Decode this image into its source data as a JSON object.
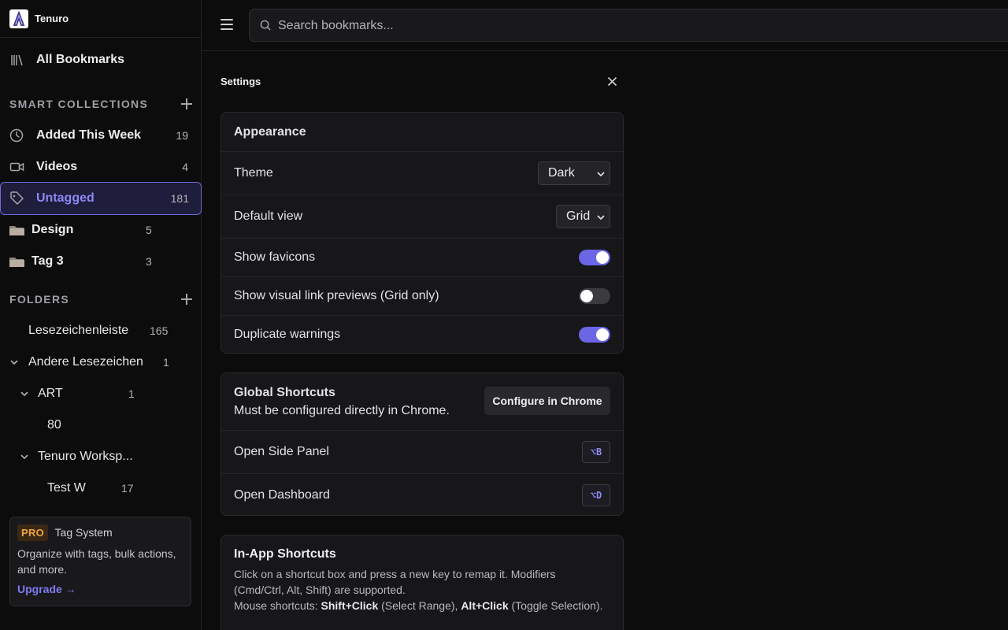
{
  "brand": {
    "name": "Tenuro"
  },
  "sidebar": {
    "all_bookmarks": "All Bookmarks",
    "smart_collections_title": "SMART COLLECTIONS",
    "smart_collections": [
      {
        "label": "Added This Week",
        "count": "19",
        "icon": "clock-icon"
      },
      {
        "label": "Videos",
        "count": "4",
        "icon": "video-icon"
      },
      {
        "label": "Untagged",
        "count": "181",
        "icon": "tag-icon",
        "active": true
      }
    ],
    "tags": [
      {
        "label": "Design",
        "count": "5",
        "icon": "folder-emoji-icon"
      },
      {
        "label": "Tag 3",
        "count": "3",
        "icon": "folder-emoji-icon"
      }
    ],
    "folders_title": "FOLDERS",
    "folders": [
      {
        "label": "Lesezeichenleiste",
        "count": "165",
        "level": 0,
        "expanded": null
      },
      {
        "label": "Andere Lesezeichen",
        "count": "1",
        "level": 0,
        "expanded": true
      },
      {
        "label": "ART",
        "count": "1",
        "level": 1,
        "expanded": true
      },
      {
        "label": "80",
        "count": "",
        "level": 2,
        "expanded": null
      },
      {
        "label": "Tenuro Worksp...",
        "count": "",
        "level": 1,
        "expanded": true
      },
      {
        "label": "Test W",
        "count": "17",
        "level": 2,
        "expanded": null
      }
    ],
    "pro": {
      "badge": "PRO",
      "title": "Tag System",
      "description": "Organize with tags, bulk actions, and more.",
      "link": "Upgrade →"
    }
  },
  "search": {
    "placeholder": "Search bookmarks..."
  },
  "settings": {
    "title": "Settings",
    "appearance": {
      "heading": "Appearance",
      "theme_label": "Theme",
      "theme_value": "Dark",
      "default_view_label": "Default view",
      "default_view_value": "Grid",
      "show_favicons_label": "Show favicons",
      "show_favicons": true,
      "visual_previews_label": "Show visual link previews (Grid only)",
      "visual_previews": false,
      "duplicate_warnings_label": "Duplicate warnings",
      "duplicate_warnings": true
    },
    "global_shortcuts": {
      "heading": "Global Shortcuts",
      "subtitle": "Must be configured directly in Chrome.",
      "configure_button": "Configure in Chrome",
      "items": [
        {
          "label": "Open Side Panel",
          "key": "⌥B"
        },
        {
          "label": "Open Dashboard",
          "key": "⌥D"
        }
      ]
    },
    "inapp_shortcuts": {
      "heading": "In-App Shortcuts",
      "line1": "Click on a shortcut box and press a new key to remap it. Modifiers (Cmd/Ctrl, Alt, Shift) are supported.",
      "mouse_prefix": "Mouse shortcuts: ",
      "shift_click": "Shift+Click",
      "shift_click_desc": " (Select Range), ",
      "alt_click": "Alt+Click",
      "alt_click_desc": " (Toggle Selection)."
    }
  },
  "colors": {
    "accent": "#6a66e6",
    "pro": "#f0a640"
  }
}
